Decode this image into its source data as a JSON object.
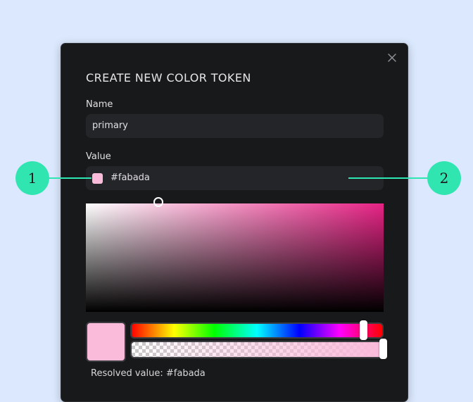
{
  "modal": {
    "title": "CREATE NEW COLOR TOKEN",
    "close_icon": "close-icon",
    "name_label": "Name",
    "name_value": "primary",
    "value_label": "Value",
    "value_text": "#fabada",
    "resolved_text": "Resolved value: #fabada"
  },
  "color_picker": {
    "selected_color": "#fabada",
    "saturation": 0.24,
    "brightness": 0.98,
    "hue_level": 0.92,
    "alpha_level": 1.0
  },
  "callouts": [
    {
      "number": "1"
    },
    {
      "number": "2"
    }
  ],
  "colors": {
    "page_background": "#dbe8fd",
    "modal_background": "#18191b",
    "input_background": "#232528",
    "callout_accent": "#31e5b1"
  }
}
